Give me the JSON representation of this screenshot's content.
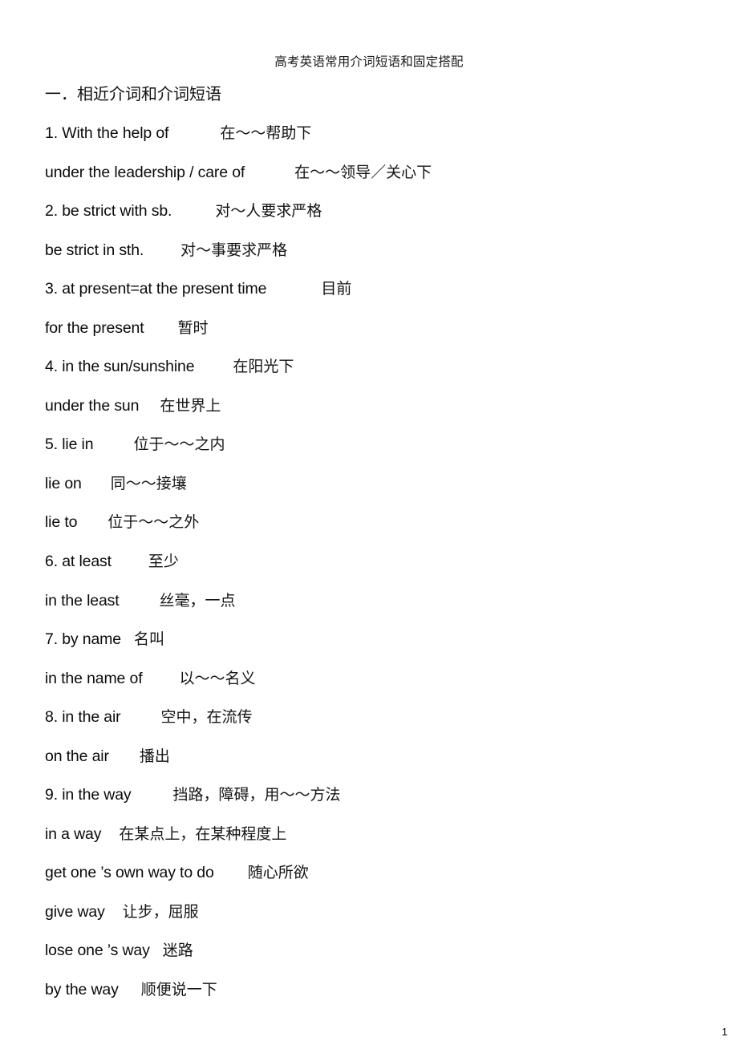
{
  "document": {
    "title": "高考英语常用介词短语和固定搭配",
    "page_number": "1"
  },
  "sections": [
    {
      "heading": "一．相近介词和介词短语"
    }
  ],
  "entries": [
    {
      "en": "1. With the help of",
      "gap": 64,
      "zh": "在～～帮助下"
    },
    {
      "en": "under the leadership / care of",
      "gap": 62,
      "zh": "在～～领导／关心下"
    },
    {
      "en": "2. be strict with sb.",
      "gap": 54,
      "zh": "对～人要求严格"
    },
    {
      "en": "be strict in sth.",
      "gap": 46,
      "zh": "对～事要求严格"
    },
    {
      "en": "3. at present=at the present time",
      "gap": 68,
      "zh": "目前"
    },
    {
      "en": "for the present",
      "gap": 42,
      "zh": "暂时"
    },
    {
      "en": "4. in the sun/sunshine",
      "gap": 48,
      "zh": "在阳光下"
    },
    {
      "en": "under the sun",
      "gap": 26,
      "zh": "在世界上"
    },
    {
      "en": "5. lie in",
      "gap": 50,
      "zh": "位于～～之内"
    },
    {
      "en": "lie on",
      "gap": 36,
      "zh": "同～～接壤"
    },
    {
      "en": "lie to",
      "gap": 38,
      "zh": "位于～～之外"
    },
    {
      "en": "6. at least",
      "gap": 46,
      "zh": "至少"
    },
    {
      "en": "in the least",
      "gap": 50,
      "zh": "丝毫，一点"
    },
    {
      "en": "7. by name",
      "gap": 16,
      "zh": "名叫"
    },
    {
      "en": "in the name of",
      "gap": 46,
      "zh": "以～～名义"
    },
    {
      "en": "8. in the air",
      "gap": 50,
      "zh": "空中，在流传"
    },
    {
      "en": "on the air",
      "gap": 38,
      "zh": "播出"
    },
    {
      "en": "9. in the way",
      "gap": 52,
      "zh": "挡路，障碍，用～～方法"
    },
    {
      "en": "in a way",
      "gap": 22,
      "zh": "在某点上，在某种程度上"
    },
    {
      "en": "get one ’s own way to do",
      "gap": 42,
      "zh": "随心所欲"
    },
    {
      "en": "give way",
      "gap": 22,
      "zh": "让步，屈服"
    },
    {
      "en": "lose one ’s way",
      "gap": 16,
      "zh": "迷路"
    },
    {
      "en": "by the way",
      "gap": 28,
      "zh": "顺便说一下"
    }
  ]
}
